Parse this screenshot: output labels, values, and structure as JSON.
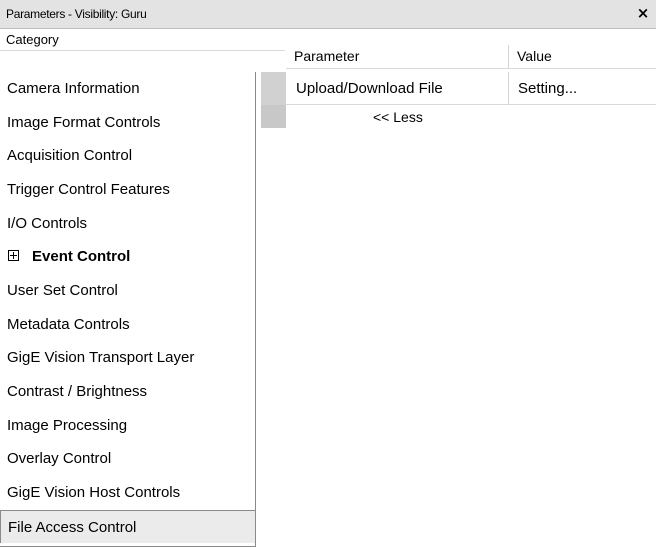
{
  "window": {
    "title": "Parameters - Visibility: Guru",
    "close_glyph": "×",
    "close_icon": "close-icon"
  },
  "category_panel": {
    "header": "Category",
    "items": [
      {
        "label": "Camera Information",
        "bold": false,
        "selected": false,
        "expandable": false
      },
      {
        "label": "Image Format Controls",
        "bold": false,
        "selected": false,
        "expandable": false
      },
      {
        "label": "Acquisition Control",
        "bold": false,
        "selected": false,
        "expandable": false
      },
      {
        "label": "Trigger Control Features",
        "bold": false,
        "selected": false,
        "expandable": false
      },
      {
        "label": "I/O Controls",
        "bold": false,
        "selected": false,
        "expandable": false
      },
      {
        "label": "Event Control",
        "bold": true,
        "selected": false,
        "expandable": true
      },
      {
        "label": "User Set Control",
        "bold": false,
        "selected": false,
        "expandable": false
      },
      {
        "label": "Metadata Controls",
        "bold": false,
        "selected": false,
        "expandable": false
      },
      {
        "label": "GigE Vision Transport Layer",
        "bold": false,
        "selected": false,
        "expandable": false
      },
      {
        "label": "Contrast / Brightness",
        "bold": false,
        "selected": false,
        "expandable": false
      },
      {
        "label": "Image Processing",
        "bold": false,
        "selected": false,
        "expandable": false
      },
      {
        "label": "Overlay Control",
        "bold": false,
        "selected": false,
        "expandable": false
      },
      {
        "label": "GigE Vision Host Controls",
        "bold": false,
        "selected": false,
        "expandable": false
      },
      {
        "label": "File Access Control",
        "bold": false,
        "selected": true,
        "expandable": false
      }
    ]
  },
  "parameter_grid": {
    "columns": [
      "Parameter",
      "Value"
    ],
    "rows": [
      {
        "parameter": "Upload/Download File",
        "value": "Setting..."
      }
    ],
    "less_link": "<< Less"
  },
  "colors": {
    "titlebar_bg": "#e3e3e3",
    "selected_bg": "#ebebeb",
    "gutter": "#cfcfcf",
    "border": "#8a8a8a"
  }
}
